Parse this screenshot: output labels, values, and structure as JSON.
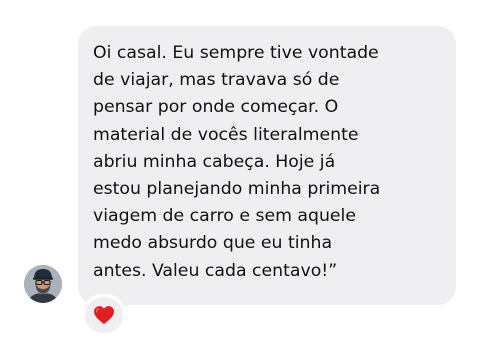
{
  "message": {
    "text": "Oi casal. Eu sempre tive vontade\nde viajar, mas travava só de\npensar por onde começar. O\nmaterial de vocês literalmente\nabriu minha cabeça. Hoje já\nestou planejando minha primeira\nviagem de carro e sem aquele\nmedo absurdo que eu tinha\nantes. Valeu cada centavo!”"
  },
  "sender": {
    "avatar_icon": "person-avatar-with-cap-and-glasses"
  },
  "reaction": {
    "icon": "heart-icon",
    "color": "#e0201f"
  },
  "colors": {
    "bubble": "#efeff1",
    "text": "#111111",
    "background": "#ffffff"
  }
}
